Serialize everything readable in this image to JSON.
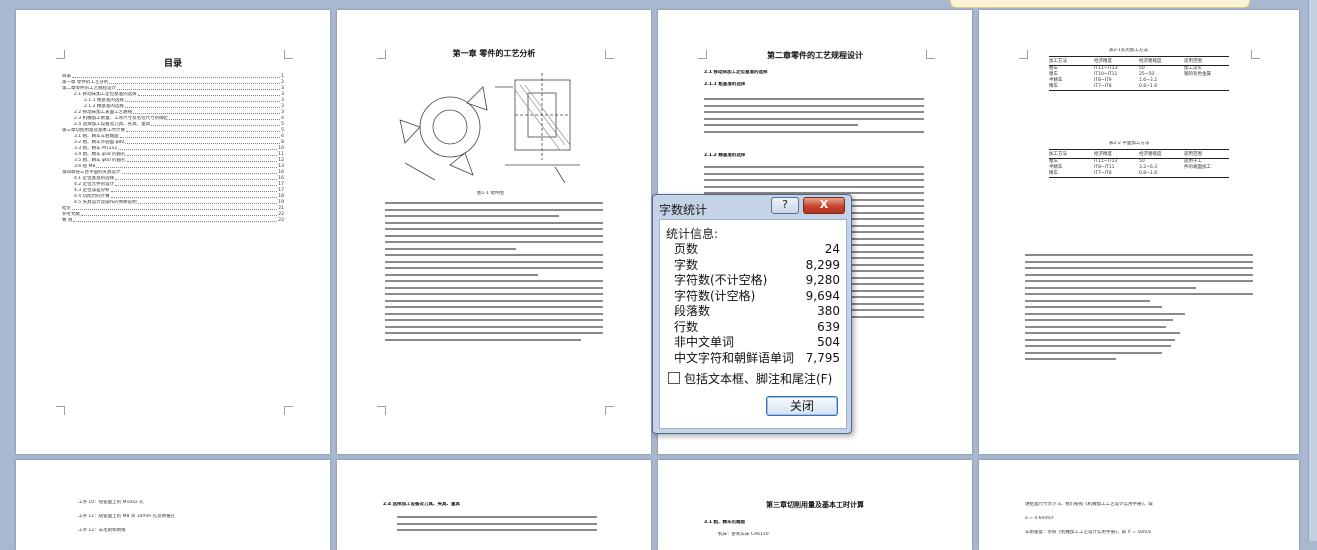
{
  "pages": {
    "p1": {
      "title": "目录",
      "toc": [
        {
          "label": "目录",
          "page": "1"
        },
        {
          "label": "第一章 零件的工艺分析",
          "page": "2"
        },
        {
          "label": "第二章零件的工艺规程设计",
          "page": "3"
        },
        {
          "label": "2.1 移动床加工定位基准的选择",
          "page": "3"
        },
        {
          "label": "2.1.1 粗基准的选择",
          "page": "3"
        },
        {
          "label": "2.1.2 精基准的选择",
          "page": "3"
        },
        {
          "label": "2.2 移动床加工表面工艺路线",
          "page": "3"
        },
        {
          "label": "2.3 机械加工余量、工序尺寸及毛坯尺寸的确定",
          "page": "4"
        },
        {
          "label": "2.4 选择加工设备及刀具、夹具、量具",
          "page": "5"
        },
        {
          "label": "第三章切削用量及基本工时计算",
          "page": "5"
        },
        {
          "label": "3.1 粗、精车车右端面",
          "page": "6"
        },
        {
          "label": "3.2 粗、精车外圆面 φ80",
          "page": "8"
        },
        {
          "label": "3.3 粗、精车 M72x2",
          "page": "10"
        },
        {
          "label": "3.4 粗、精车 φ58 的圆孔",
          "page": "11"
        },
        {
          "label": "3.5 粗、精车 φ60 的圆孔",
          "page": "12"
        },
        {
          "label": "3.6 钻 M8",
          "page": "13"
        },
        {
          "label": "第四章铣三台平面的夹具设计",
          "page": "16"
        },
        {
          "label": "4.1 定位基准的选择",
          "page": "16"
        },
        {
          "label": "4.2 定位元件的设计",
          "page": "17"
        },
        {
          "label": "4.3 定位误差分析",
          "page": "17"
        },
        {
          "label": "4.4 切削力的计算",
          "page": "18"
        },
        {
          "label": "4.5 夹具设计及操作的简要说明",
          "page": "19"
        },
        {
          "label": "结论",
          "page": "21"
        },
        {
          "label": "参考文献",
          "page": "22"
        },
        {
          "label": "致 谢",
          "page": "22"
        }
      ]
    },
    "p2": {
      "title": "第一章 零件的工艺分析",
      "caption": "图1-1 零件图"
    },
    "p3": {
      "title": "第二章零件的工艺规程设计",
      "h1": "2.1 移动床加工定位基准的选择",
      "h2": "2.1.1 粗基准的选择",
      "h3": "2.1.2 精基准的选择"
    },
    "p4": {
      "table1_title": "表2-1孔的加工方法",
      "table2_title": "表2-2 平面加工方法",
      "table_headers": [
        "加工方法",
        "经济精度",
        "经济粗糙度",
        "适用范围"
      ],
      "table1_rows": [
        [
          "粗车",
          "IT11~IT13",
          "50",
          "加工淬火"
        ],
        [
          "粗车",
          "IT10~IT11",
          "25~50",
          "钢的有色金属"
        ],
        [
          "半精车",
          "IT8~IT9",
          "1.6~3.2",
          ""
        ],
        [
          "精车",
          "IT7~IT8",
          "0.8~1.6",
          ""
        ]
      ],
      "table2_rows": [
        [
          "粗车",
          "IT11~IT13",
          "50",
          "适用于工"
        ],
        [
          "半精车",
          "IT8~IT11",
          "3.2~6.3",
          "件的端面加工"
        ],
        [
          "精车",
          "IT7~IT8",
          "0.8~1.6",
          ""
        ]
      ]
    },
    "p5": {
      "lines": [
        "工序 10：钻钳面上的 M10x2 孔",
        "工序 11：钻钳面上的 M8 深 10mm 孔及倒锥孔",
        "工序 12：去毛刺和倒角"
      ]
    },
    "p6": {
      "heading": "2.4 选择加工设备及刀具、夹具、量具"
    },
    "p7": {
      "title": "第三章切削用量及基本工时计算",
      "h1": "3.1 粗、精车右端面",
      "line": "机床：卧式车床 CA6150"
    },
    "p8": {
      "lines": [
        "进给量尺寸大小 a，我们按照《机械加工工艺设计实用手册》，取",
        "a = 0.6mm/r",
        "车削速度：参照《机械加工工艺设计实用手册》，取 V = 50m/s"
      ]
    }
  },
  "dialog": {
    "title": "字数统计",
    "help_label": "?",
    "close_label": "X",
    "section_label": "统计信息:",
    "stats": [
      {
        "label": "页数",
        "value": "24"
      },
      {
        "label": "字数",
        "value": "8,299"
      },
      {
        "label": "字符数(不计空格)",
        "value": "9,280"
      },
      {
        "label": "字符数(计空格)",
        "value": "9,694"
      },
      {
        "label": "段落数",
        "value": "380"
      },
      {
        "label": "行数",
        "value": "639"
      },
      {
        "label": "非中文单词",
        "value": "504"
      },
      {
        "label": "中文字符和朝鲜语单词",
        "value": "7,795"
      }
    ],
    "checkbox_label": "包括文本框、脚注和尾注(F)",
    "checkbox_checked": false,
    "ok_label": "关闭"
  }
}
